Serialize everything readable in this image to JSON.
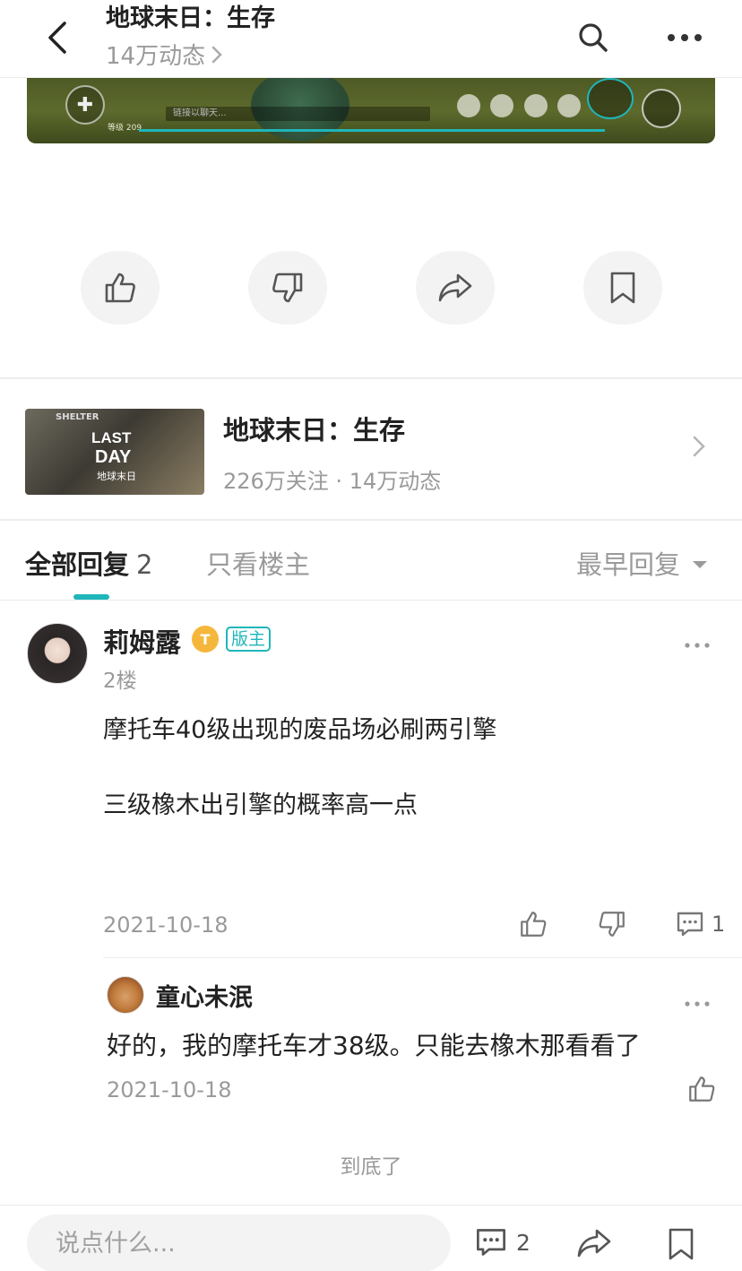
{
  "header": {
    "title": "地球末日：生存",
    "subtitle": "14万动态"
  },
  "game_strip": {
    "level_text": "等级 209",
    "chat_placeholder": "链接以聊天..."
  },
  "game_card": {
    "thumb_text_shelter": "SHELTER",
    "thumb_logo_line1": "LAST",
    "thumb_logo_line2": "DAY",
    "thumb_logo_line3": "地球末日",
    "name": "地球末日：生存",
    "stats": "226万关注 · 14万动态"
  },
  "tabs": {
    "all_label": "全部回复",
    "all_count": "2",
    "op_only_label": "只看楼主",
    "sort_label": "最早回复"
  },
  "reply": {
    "author": "莉姆露",
    "badge_t": "T",
    "badge_role": "版主",
    "floor": "2楼",
    "line1": "摩托车40级出现的废品场必刷两引擎",
    "line2": "三级橡木出引擎的概率高一点",
    "date": "2021-10-18",
    "comment_count": "1"
  },
  "sub_reply": {
    "author": "童心未泯",
    "text": "好的，我的摩托车才38级。只能去橡木那看看了",
    "date": "2021-10-18"
  },
  "end_text": "到底了",
  "bottom_bar": {
    "input_placeholder": "说点什么...",
    "comment_count": "2"
  },
  "colors": {
    "accent": "#1fb6b9",
    "muted": "#9a9a9a",
    "text": "#222222"
  }
}
